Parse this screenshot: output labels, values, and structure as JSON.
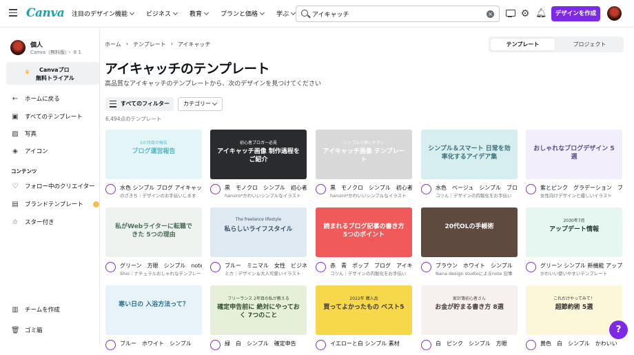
{
  "header": {
    "logo": "Canva",
    "nav": [
      "注目のデザイン機能",
      "ビジネス",
      "教育",
      "プランと価格",
      "学ぶ"
    ],
    "search_value": "アイキャッチ",
    "create_button": "デザインを作成"
  },
  "sidebar": {
    "account_name": "個人",
    "account_sub": "Canva（無料版）・ 8 1",
    "trial_line1": "Canvaプロ",
    "trial_line2": "無料トライアル",
    "items": [
      {
        "label": "ホームに戻る",
        "icon": "arrow-left-icon"
      },
      {
        "label": "すべてのテンプレート",
        "icon": "template-icon"
      },
      {
        "label": "写真",
        "icon": "photo-icon"
      },
      {
        "label": "アイコン",
        "icon": "shapes-icon"
      }
    ],
    "section_heading": "コンテンツ",
    "content_items": [
      {
        "label": "フォロー中のクリエイター",
        "icon": "heart-icon"
      },
      {
        "label": "ブランドテンプレート",
        "icon": "brand-icon"
      },
      {
        "label": "スター付き",
        "icon": "star-icon"
      }
    ],
    "bottom_items": [
      {
        "label": "チームを作成",
        "icon": "team-icon"
      },
      {
        "label": "ゴミ箱",
        "icon": "trash-icon"
      }
    ]
  },
  "main": {
    "breadcrumb": [
      "ホーム",
      "テンプレート",
      "アイキャッチ"
    ],
    "tabs": [
      "テンプレート",
      "プロジェクト"
    ],
    "title": "アイキャッチのテンプレート",
    "subtitle": "高品質なアイキャッチのテンプレートから、次のデザインを見つけてください",
    "filter_button": "すべてのフィルター",
    "category_dropdown": "カテゴリー",
    "result_count": "6,494点のテンプレート"
  },
  "cards": [
    {
      "title": "水色 シンプル ブログ アイキャッチ",
      "author": "のざきち｜デザインのお手伝いします",
      "bg": "#e4f5f7",
      "thumb_text": "ブログ運営報告",
      "thumb_sub": "5か月目の報告",
      "text_color": "#5bb6c4"
    },
    {
      "title": "黒　モノクロ　シンプル　初心者",
      "author": "haruiro*かわいいシンプルなイラスト",
      "bg": "#2a2b2e",
      "thumb_text": "アイキャッチ画像 制作過程をご紹介",
      "thumb_sub": "初心者ブロガー必見",
      "text_color": "#ffffff"
    },
    {
      "title": "黒　モノクロ　シンプル　初心者",
      "author": "haruiro*かわいいシンプルなイラスト",
      "bg": "#d8d8d8",
      "thumb_text": "アイキャッチ画像 テンプレート",
      "thumb_sub": "シンプルで使いやすい",
      "text_color": "#ffffff"
    },
    {
      "title": "水色　ベージュ　シンプル　ブログ",
      "author": "コツん｜デザインの内製化をお手伝い",
      "bg": "#d7eeee",
      "thumb_text": "シンプル＆スマート 日常を効率化するアイデア集",
      "thumb_sub": "",
      "text_color": "#3a6f7a"
    },
    {
      "title": "紫とピンク　グラデーション　ブログ",
      "author": "女性向けデザインと優しいイラスト",
      "bg": "#f2eefb",
      "thumb_text": "おしゃれなブログデザイン 5選",
      "thumb_sub": "",
      "text_color": "#5a4f8a"
    },
    {
      "title": "グリーン　方眼　シンプル　note",
      "author": "Shio｜ナチュラルおしゃれなテンプレート",
      "bg": "#eef3ef",
      "thumb_text": "私がWebライターに転職できた 5つの理由",
      "thumb_sub": "",
      "text_color": "#4b6f5a"
    },
    {
      "title": "ブルー　ミニマル　女性　ビジネス",
      "author": "ミカ｜デザイン＆大人可愛いイラスト",
      "bg": "#dfe9f1",
      "thumb_text": "私らしいライフスタイル",
      "thumb_sub": "The freelance lifestyle",
      "text_color": "#3a4f66"
    },
    {
      "title": "赤　青　ポップ　ブログ　アイキャッチ",
      "author": "コツん｜デザインの内製化をお手伝い",
      "bg": "#f05a5a",
      "thumb_text": "読まれるブログ記事の書き方 5つのポイント",
      "thumb_sub": "",
      "text_color": "#ffffff"
    },
    {
      "title": "ブラウン　ホワイト　シンプル　note 記事",
      "author": "Nana design studioによるnote 記事",
      "bg": "#5e4a3e",
      "thumb_text": "20代OLの手帳術",
      "thumb_sub": "",
      "text_color": "#ffffff"
    },
    {
      "title": "グリーン シンプル 新機能 アップデート",
      "author": "かわいい使いやすいテンプレート",
      "bg": "#e6f6f1",
      "thumb_text": "アップデート情報",
      "thumb_sub": "2030年7月",
      "text_color": "#1f3a33"
    },
    {
      "title": "ブルー　ホワイト　シンプル",
      "author": "",
      "bg": "#e7f3f8",
      "thumb_text": "寒い日の 入浴方法って？",
      "thumb_sub": "",
      "text_color": "#2a6f8f"
    },
    {
      "title": "緑　白　シンプル　確定申告",
      "author": "",
      "bg": "#e6f0d9",
      "thumb_text": "確定申告前に 絶対にやっておく 7つのこと",
      "thumb_sub": "フリーランス 2年目の私が教える",
      "text_color": "#2e4d2e"
    },
    {
      "title": "イエローと白 シンプル 素材",
      "author": "",
      "bg": "#f7d84a",
      "thumb_text": "買ってよかったもの ベスト5",
      "thumb_sub": "2022年 購入品",
      "text_color": "#3a3a3a"
    },
    {
      "title": "白　ピンク　シンプル　方眼",
      "author": "",
      "bg": "#f6f1ef",
      "thumb_text": "お金が貯まる書き方 8選",
      "thumb_sub": "家計簿初心者さん",
      "text_color": "#4a3a3a"
    },
    {
      "title": "黄色　白　シンプル　かわいい",
      "author": "",
      "bg": "#fdf7d9",
      "thumb_text": "超節約術 5選",
      "thumb_sub": "これだけやってみて！",
      "text_color": "#2e2e2e"
    }
  ]
}
